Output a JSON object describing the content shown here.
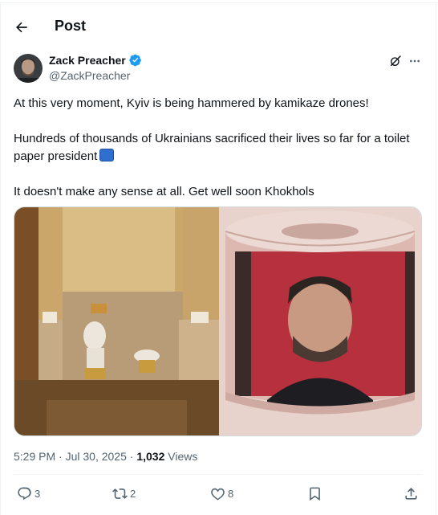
{
  "header": {
    "title": "Post"
  },
  "author": {
    "display_name": "Zack Preacher",
    "handle": "@ZackPreacher",
    "verified": true
  },
  "post": {
    "paragraph_1": "At this very moment, Kyiv is being hammered by kamikaze drones!",
    "paragraph_2": "Hundreds of thousands of Ukrainians sacrificed their lives so far for a toilet paper president",
    "paragraph_3": "It doesn't make any sense at all. Get well soon Khokhols"
  },
  "meta": {
    "timestamp": "5:29 PM · Jul 30, 2025",
    "separator": " · ",
    "views_count": "1,032",
    "views_label": " Views"
  },
  "actions": {
    "replies": "3",
    "reposts": "2",
    "likes": "8"
  },
  "colors": {
    "text": "#0f1419",
    "secondary": "#536471",
    "border": "#cfd9de",
    "verified": "#1d9bf0"
  }
}
